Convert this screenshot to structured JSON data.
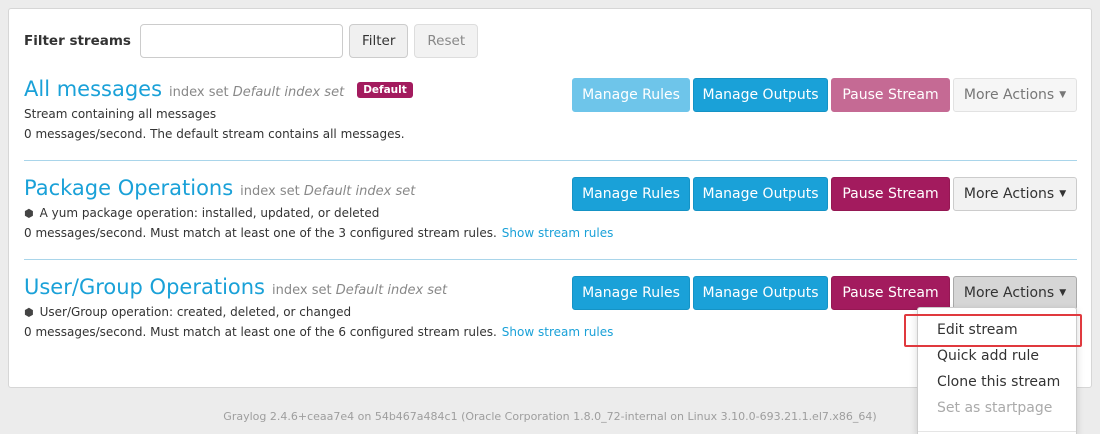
{
  "filter": {
    "label": "Filter streams",
    "value": "",
    "placeholder": "",
    "filter_button": "Filter",
    "reset_button": "Reset"
  },
  "actions_labels": {
    "manage_rules": "Manage Rules",
    "manage_outputs": "Manage Outputs",
    "pause_stream": "Pause Stream",
    "more_actions": "More Actions"
  },
  "streams": [
    {
      "name": "All messages",
      "index_set_prefix": "index set",
      "index_set_name": "Default index set",
      "badge": "Default",
      "description": "Stream containing all messages",
      "stats": "0 messages/second. The default stream contains all messages.",
      "link": ""
    },
    {
      "name": "Package Operations",
      "index_set_prefix": "index set",
      "index_set_name": "Default index set",
      "badge": "",
      "description": "A yum package operation: installed, updated, or deleted",
      "stats": "0 messages/second. Must match at least one of the 3 configured stream rules.",
      "link": "Show stream rules"
    },
    {
      "name": "User/Group Operations",
      "index_set_prefix": "index set",
      "index_set_name": "Default index set",
      "badge": "",
      "description": "User/Group operation: created, deleted, or changed",
      "stats": "0 messages/second. Must match at least one of the 6 configured stream rules.",
      "link": "Show stream rules"
    }
  ],
  "dropdown": {
    "items": [
      "Edit stream",
      "Quick add rule",
      "Clone this stream",
      "Set as startpage"
    ],
    "highlighted": "Edit stream",
    "disabled": [
      "Set as startpage"
    ]
  },
  "footer": "Graylog 2.4.6+ceaa7e4 on 54b467a484c1 (Oracle Corporation 1.8.0_72-internal on Linux 3.10.0-693.21.1.el7.x86_64)",
  "colors": {
    "info": "#1aa1d8",
    "danger": "#a31b5e",
    "highlight_box": "#e0393e"
  }
}
